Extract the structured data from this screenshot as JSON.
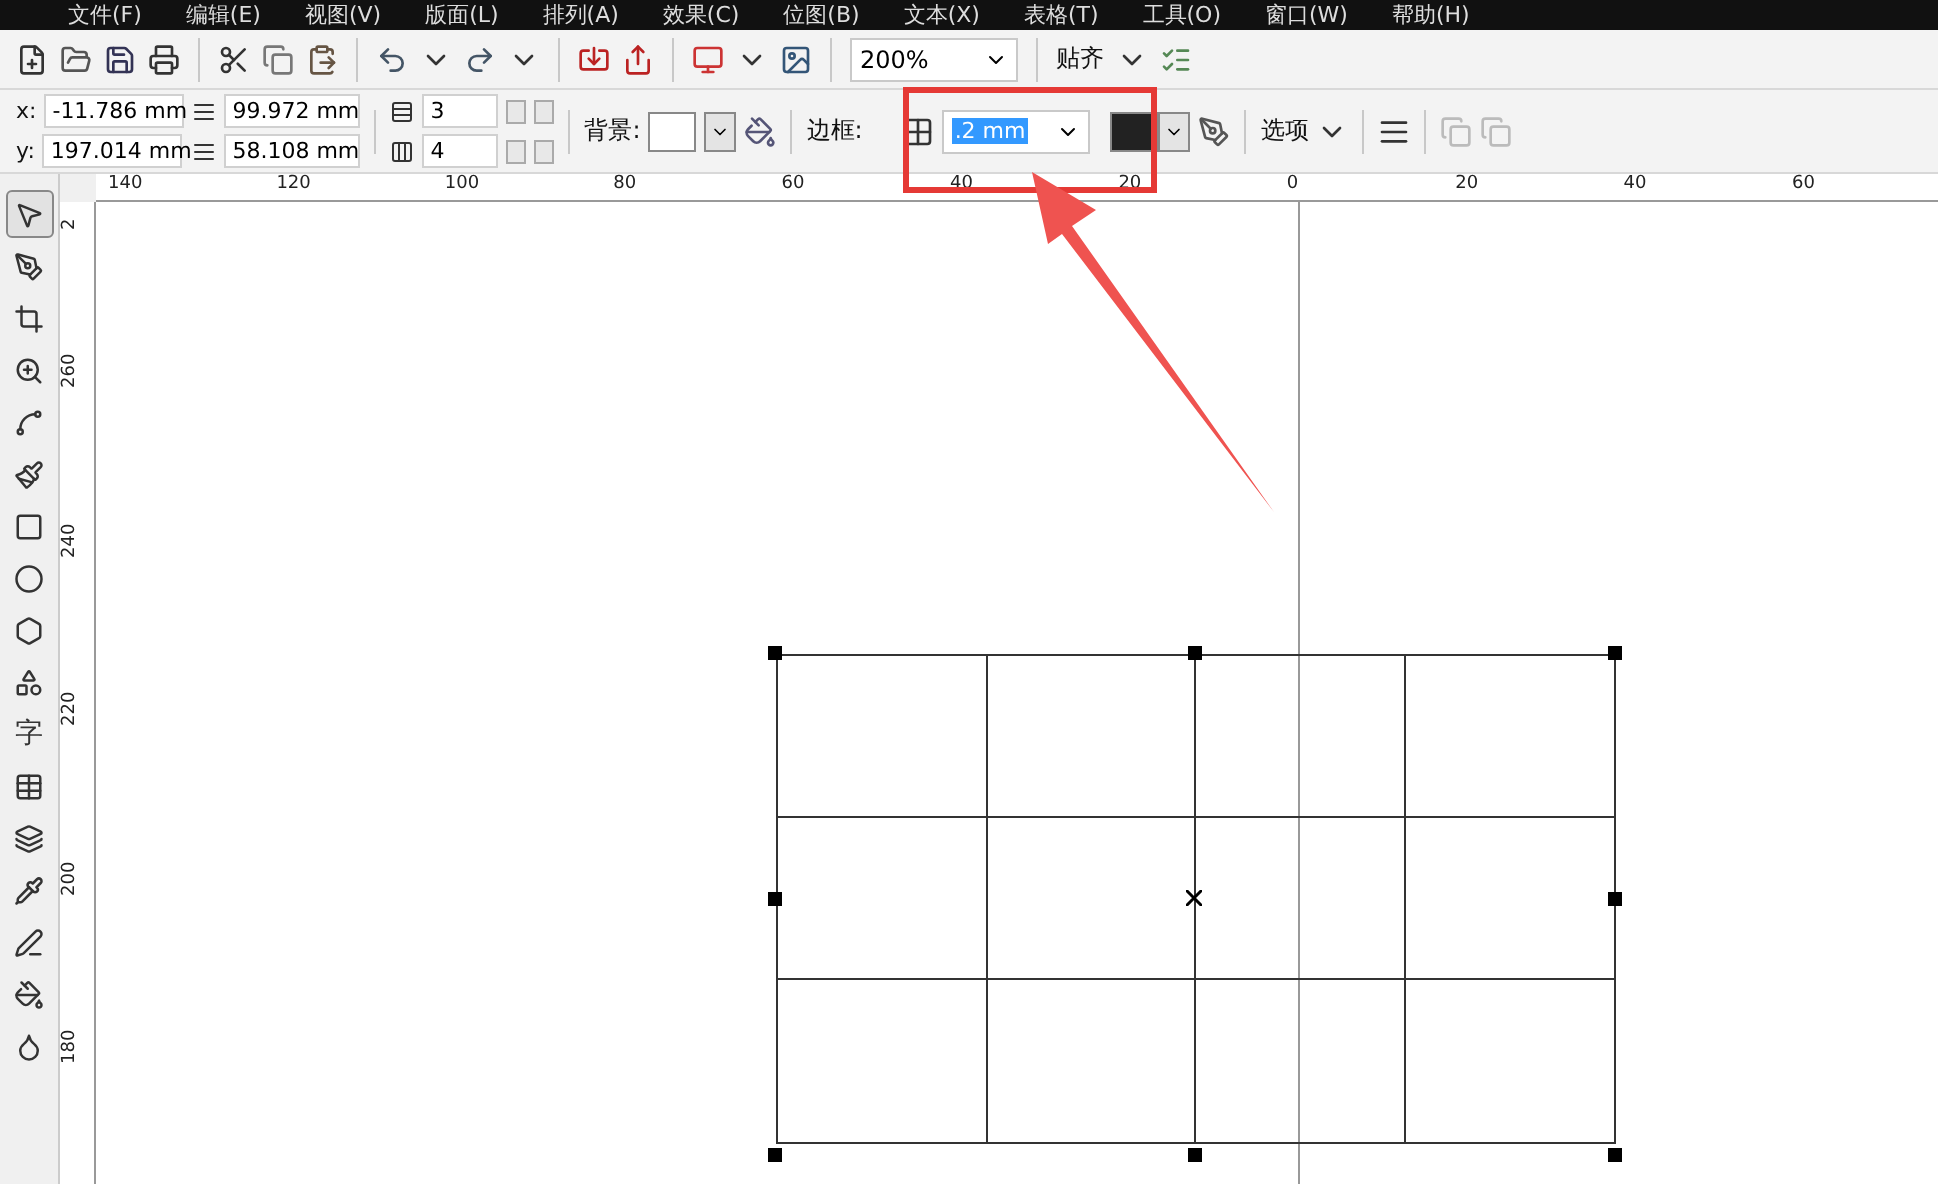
{
  "menu": [
    "文件(F)",
    "编辑(E)",
    "视图(V)",
    "版面(L)",
    "排列(A)",
    "效果(C)",
    "位图(B)",
    "文本(X)",
    "表格(T)",
    "工具(O)",
    "窗口(W)",
    "帮助(H)"
  ],
  "toolbar": {
    "zoom": "200%",
    "snap": "贴齐"
  },
  "property_bar": {
    "x_label": "x:",
    "x": "-11.786 mm",
    "y_label": "y:",
    "y": "197.014 mm",
    "width": "99.972 mm",
    "height": "58.108 mm",
    "rows": "3",
    "columns": "4",
    "background_label": "背景:",
    "border_label": "边框:",
    "border_width": ".2 mm",
    "border_width_text_selected": true,
    "options": "选项"
  },
  "toolbox": [
    {
      "kind": "pick",
      "selected": true
    },
    {
      "kind": "shape",
      "selected": false
    },
    {
      "kind": "crop",
      "selected": false
    },
    {
      "kind": "zoom",
      "selected": false
    },
    {
      "kind": "curve",
      "selected": false
    },
    {
      "kind": "smart",
      "selected": false
    },
    {
      "kind": "rectangle",
      "selected": false
    },
    {
      "kind": "ellipse",
      "selected": false
    },
    {
      "kind": "polygon",
      "selected": false
    },
    {
      "kind": "basic-shapes",
      "selected": false
    },
    {
      "kind": "text",
      "label": "字",
      "selected": false
    },
    {
      "kind": "table",
      "selected": false
    },
    {
      "kind": "blend",
      "selected": false
    },
    {
      "kind": "eyedropper",
      "selected": false
    },
    {
      "kind": "outline",
      "selected": false
    },
    {
      "kind": "fill",
      "selected": false
    },
    {
      "kind": "interactive-fill",
      "selected": false
    }
  ],
  "horizontal_ruler": [
    "140",
    "120",
    "100",
    "80",
    "60",
    "40",
    "20",
    "0",
    "20",
    "40",
    "60"
  ],
  "vertical_ruler": [
    "2",
    "260",
    "240",
    "220",
    "200",
    "180"
  ]
}
